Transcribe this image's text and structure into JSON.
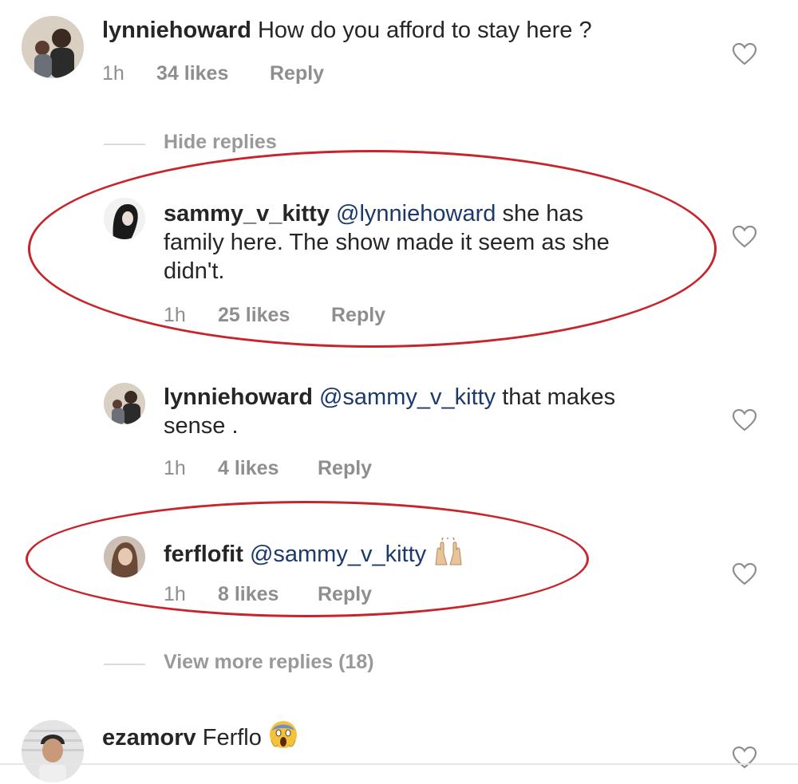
{
  "comments": [
    {
      "username": "lynniehoward",
      "mention": "",
      "text": "How do you afford to stay here ?",
      "time": "1h",
      "likes": "34 likes",
      "reply": "Reply"
    },
    {
      "username": "sammy_v_kitty",
      "mention": "@lynniehoward",
      "text_line1": "she has",
      "text_line2": "family here. The show made it seem as she",
      "text_line3": "didn't.",
      "time": "1h",
      "likes": "25 likes",
      "reply": "Reply"
    },
    {
      "username": "lynniehoward",
      "mention": "@sammy_v_kitty",
      "text_line1": "that makes",
      "text_line2": "sense .",
      "time": "1h",
      "likes": "4 likes",
      "reply": "Reply"
    },
    {
      "username": "ferflofit",
      "mention": "@sammy_v_kitty",
      "emoji": "raising-hands-emoji",
      "time": "1h",
      "likes": "8 likes",
      "reply": "Reply"
    },
    {
      "username": "ezamorv",
      "text": "Ferflo",
      "emoji": "screaming-face-emoji"
    }
  ],
  "thread": {
    "hide_replies": "Hide replies",
    "view_more_replies": "View more replies (18)"
  },
  "icons": {
    "like": "heart-icon"
  },
  "colors": {
    "annotation_oval": "#c8242c",
    "meta_text": "#8e8e8e",
    "mention": "#1b3a6b"
  }
}
